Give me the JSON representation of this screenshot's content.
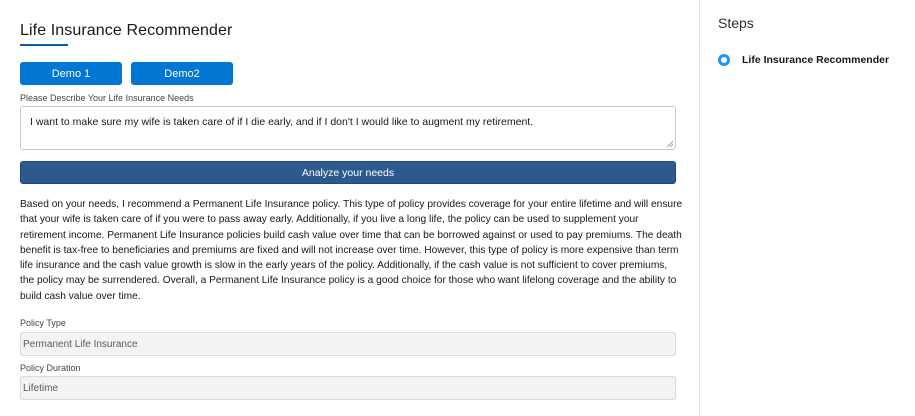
{
  "header": {
    "title": "Life Insurance Recommender"
  },
  "buttons": {
    "demo1": "Demo 1",
    "demo2": "Demo2",
    "analyze": "Analyze your needs"
  },
  "needs": {
    "label": "Please Describe Your Life Insurance Needs",
    "value": "I want to make sure my wife is taken care of if I die early, and if I don't I would like to augment my retirement."
  },
  "recommendation": {
    "text": "Based on your needs, I recommend a Permanent Life Insurance policy. This type of policy provides coverage for your entire lifetime and will ensure that your wife is taken care of if you were to pass away early. Additionally, if you live a long life, the policy can be used to supplement your retirement income. Permanent Life Insurance policies build cash value over time that can be borrowed against or used to pay premiums. The death benefit is tax-free to beneficiaries and premiums are fixed and will not increase over time. However, this type of policy is more expensive than term life insurance and the cash value growth is slow in the early years of the policy. Additionally, if the cash value is not sufficient to cover premiums, the policy may be surrendered. Overall, a Permanent Life Insurance policy is a good choice for those who want lifelong coverage and the ability to build cash value over time."
  },
  "policy_type": {
    "label": "Policy Type",
    "value": "Permanent Life Insurance"
  },
  "policy_duration": {
    "label": "Policy Duration",
    "value": "Lifetime"
  },
  "steps": {
    "title": "Steps",
    "items": [
      {
        "label": "Life Insurance Recommender",
        "icon": "step-active-dot-icon"
      }
    ]
  },
  "colors": {
    "primary_button": "#0176d3",
    "analyze_button": "#2d5a8e",
    "step_dot": "#1b96ff",
    "title_underline": "#0b5cab"
  }
}
